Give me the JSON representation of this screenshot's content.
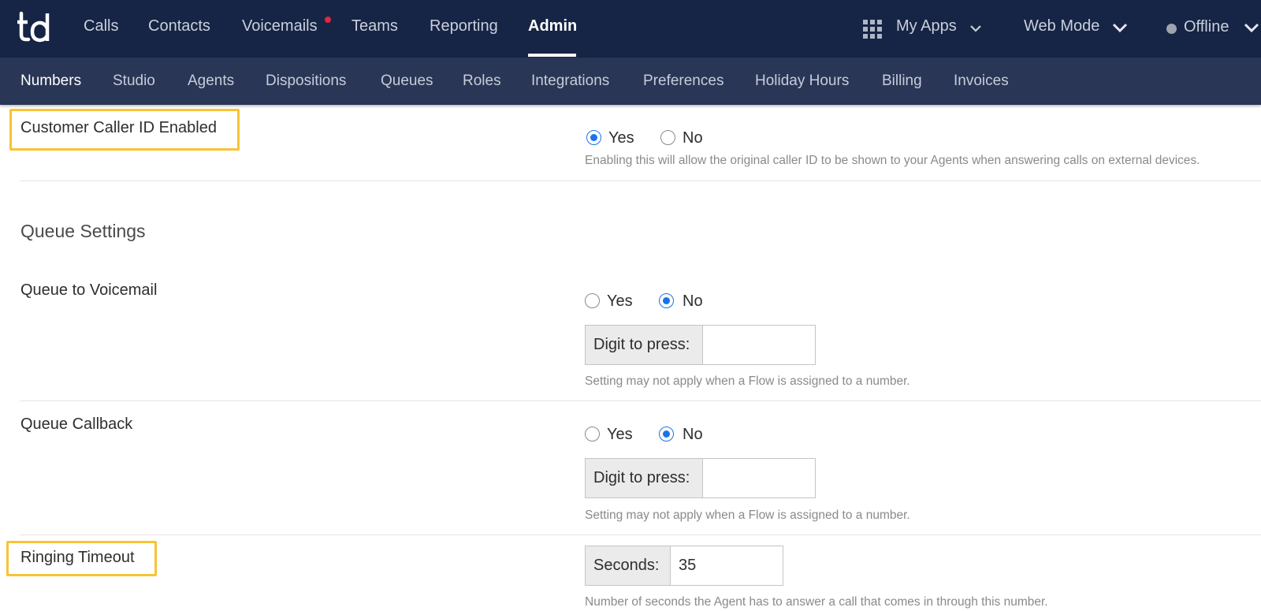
{
  "brand": {
    "logo_text": "td"
  },
  "topnav": {
    "items": [
      "Calls",
      "Contacts",
      "Voicemails",
      "Teams",
      "Reporting",
      "Admin"
    ],
    "active": "Admin",
    "my_apps": "My Apps",
    "web_mode": "Web Mode",
    "status": "Offline"
  },
  "subnav": {
    "items": [
      "Numbers",
      "Studio",
      "Agents",
      "Dispositions",
      "Queues",
      "Roles",
      "Integrations",
      "Preferences",
      "Holiday Hours",
      "Billing",
      "Invoices"
    ],
    "active": "Numbers"
  },
  "settings": {
    "customer_caller_id": {
      "label": "Customer Caller ID Enabled",
      "yes": "Yes",
      "no": "No",
      "selected": "Yes",
      "help": "Enabling this will allow the original caller ID to be shown to your Agents when answering calls on external devices."
    },
    "queue_section_title": "Queue Settings",
    "queue_to_voicemail": {
      "label": "Queue to Voicemail",
      "yes": "Yes",
      "no": "No",
      "selected": "No",
      "digit_label": "Digit to press:",
      "digit_value": "",
      "help": "Setting may not apply when a Flow is assigned to a number."
    },
    "queue_callback": {
      "label": "Queue Callback",
      "yes": "Yes",
      "no": "No",
      "selected": "No",
      "digit_label": "Digit to press:",
      "digit_value": "",
      "help": "Setting may not apply when a Flow is assigned to a number."
    },
    "ringing_timeout": {
      "label": "Ringing Timeout",
      "seconds_label": "Seconds:",
      "seconds_value": "35",
      "help": "Number of seconds the Agent has to answer a call that comes in through this number."
    }
  },
  "colors": {
    "topbar": "#162445",
    "subbar": "#2a3656",
    "highlight": "#f7c434",
    "radio_selected": "#1a73e8",
    "notification": "#e0283c"
  }
}
